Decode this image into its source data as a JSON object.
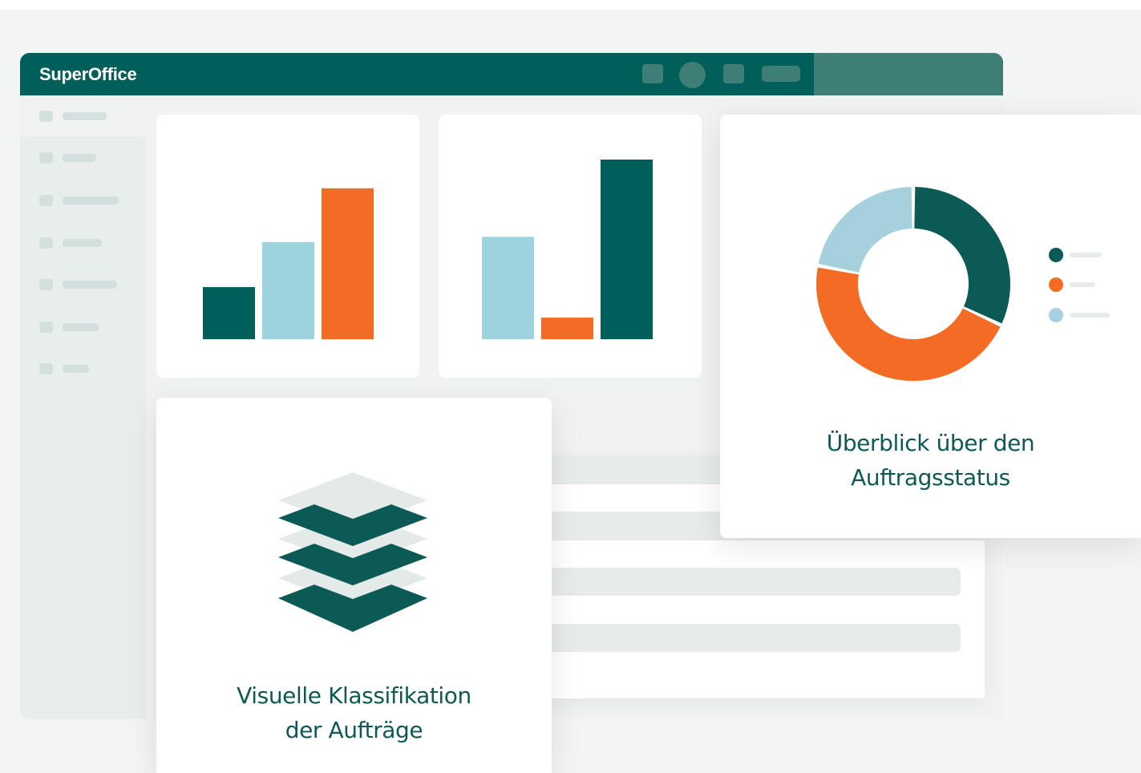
{
  "app": {
    "title": "SuperOffice"
  },
  "colors": {
    "brand_dark": "#015f59",
    "brand_mid": "#3f7d77",
    "orange": "#f46c23",
    "light_blue": "#9dd3dd",
    "donut_light_blue": "#a6d1dc",
    "caption_text": "#0c5a55"
  },
  "titlebar": {
    "icons": [
      "square-icon",
      "avatar-circle-icon",
      "square-icon",
      "pill-icon"
    ]
  },
  "sidebar": {
    "items": [
      {
        "icon": "nav-dot-icon",
        "active": true
      },
      {
        "icon": "nav-dot-icon",
        "active": false
      },
      {
        "icon": "nav-dot-icon",
        "active": false
      },
      {
        "icon": "nav-dot-icon",
        "active": false
      },
      {
        "icon": "nav-dot-icon",
        "active": false
      },
      {
        "icon": "nav-dot-icon",
        "active": false
      },
      {
        "icon": "nav-dot-icon",
        "active": false
      }
    ]
  },
  "chart_data": [
    {
      "type": "bar",
      "categories": [
        "",
        "",
        ""
      ],
      "values": [
        29,
        54,
        84
      ],
      "colors": [
        "#015f59",
        "#9dd3dd",
        "#f46c23"
      ],
      "ylim": [
        0,
        100
      ],
      "grid": false
    },
    {
      "type": "bar",
      "categories": [
        "",
        "",
        ""
      ],
      "values": [
        57,
        12,
        100
      ],
      "colors": [
        "#9dd3dd",
        "#f46c23",
        "#015f59"
      ],
      "ylim": [
        0,
        100
      ],
      "grid": false
    },
    {
      "type": "pie",
      "donut": true,
      "values": [
        32,
        46,
        22
      ],
      "colors": [
        "#0c5a55",
        "#f46c23",
        "#a6d1dc"
      ],
      "legend_position": "right"
    }
  ],
  "cards": {
    "order_status_caption_line1": "Überblick über den",
    "order_status_caption_line2": "Auftragsstatus",
    "classification_caption_line1": "Visuelle Klassifikation",
    "classification_caption_line2": "der Aufträge",
    "classification_icon": "layers-stack-icon"
  }
}
